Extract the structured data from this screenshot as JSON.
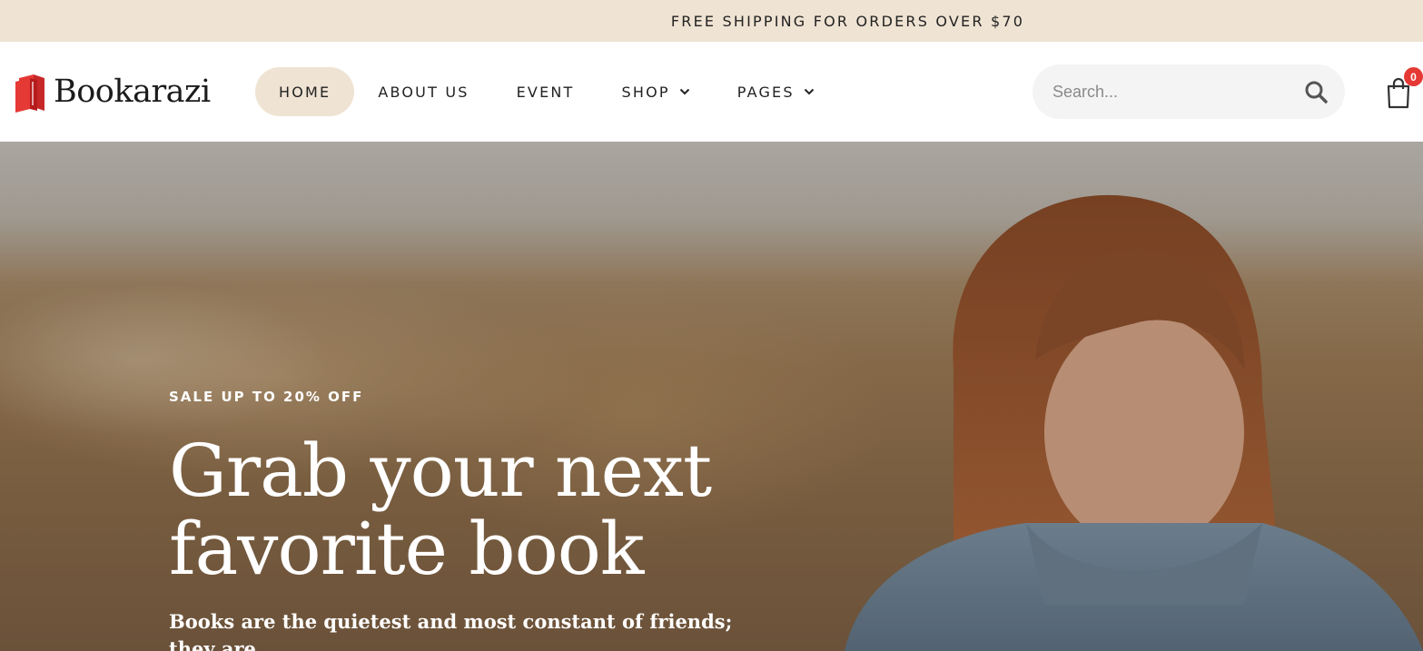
{
  "topbar": {
    "text": "FREE SHIPPING FOR ORDERS OVER $70"
  },
  "header": {
    "logo_text": "Bookarazi",
    "logo_icon": "books-icon",
    "nav": [
      {
        "label": "HOME",
        "active": true,
        "dropdown": false
      },
      {
        "label": "ABOUT US",
        "active": false,
        "dropdown": false
      },
      {
        "label": "EVENT",
        "active": false,
        "dropdown": false
      },
      {
        "label": "SHOP",
        "active": false,
        "dropdown": true
      },
      {
        "label": "PAGES",
        "active": false,
        "dropdown": true
      }
    ],
    "search": {
      "placeholder": "Search...",
      "value": ""
    },
    "cart": {
      "count": "0"
    }
  },
  "hero": {
    "eyebrow": "SALE UP TO 20% OFF",
    "headline": "Grab your next favorite book",
    "subtext": "Books are the quietest and most constant of friends; they are"
  },
  "colors": {
    "accent_beige": "#efe3d3",
    "badge_red": "#e53935",
    "logo_red": "#e53935",
    "text_dark": "#222222"
  }
}
